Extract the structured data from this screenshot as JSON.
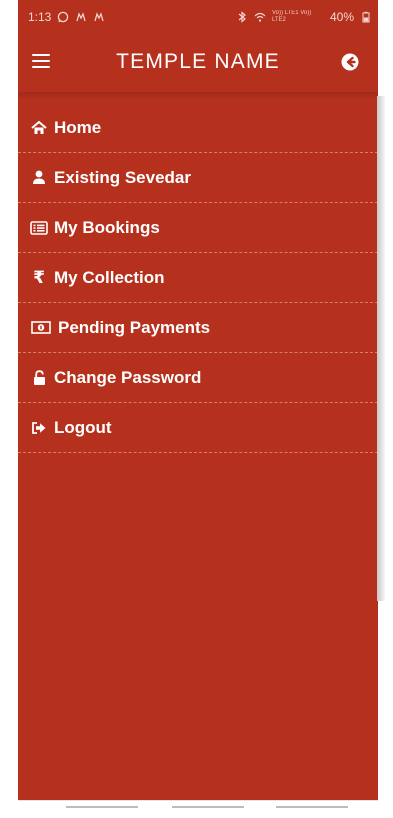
{
  "status_bar": {
    "time": "1:13",
    "battery": "40%",
    "signal_text": "Vo)) LTE1 Vo)) LTE2"
  },
  "app_bar": {
    "title": "TEMPLE NAME",
    "menu_icon": "hamburger-icon",
    "back_icon": "arrow-left-circle-icon"
  },
  "menu": {
    "items": [
      {
        "label": "Home",
        "icon": "home-icon"
      },
      {
        "label": "Existing Sevedar",
        "icon": "user-icon"
      },
      {
        "label": "My Bookings",
        "icon": "list-icon"
      },
      {
        "label": "My Collection",
        "icon": "rupee-icon"
      },
      {
        "label": "Pending Payments",
        "icon": "money-icon"
      },
      {
        "label": "Change Password",
        "icon": "lock-icon"
      },
      {
        "label": "Logout",
        "icon": "logout-icon"
      }
    ]
  },
  "colors": {
    "primary": "#b5311e",
    "text": "#ffffff"
  }
}
